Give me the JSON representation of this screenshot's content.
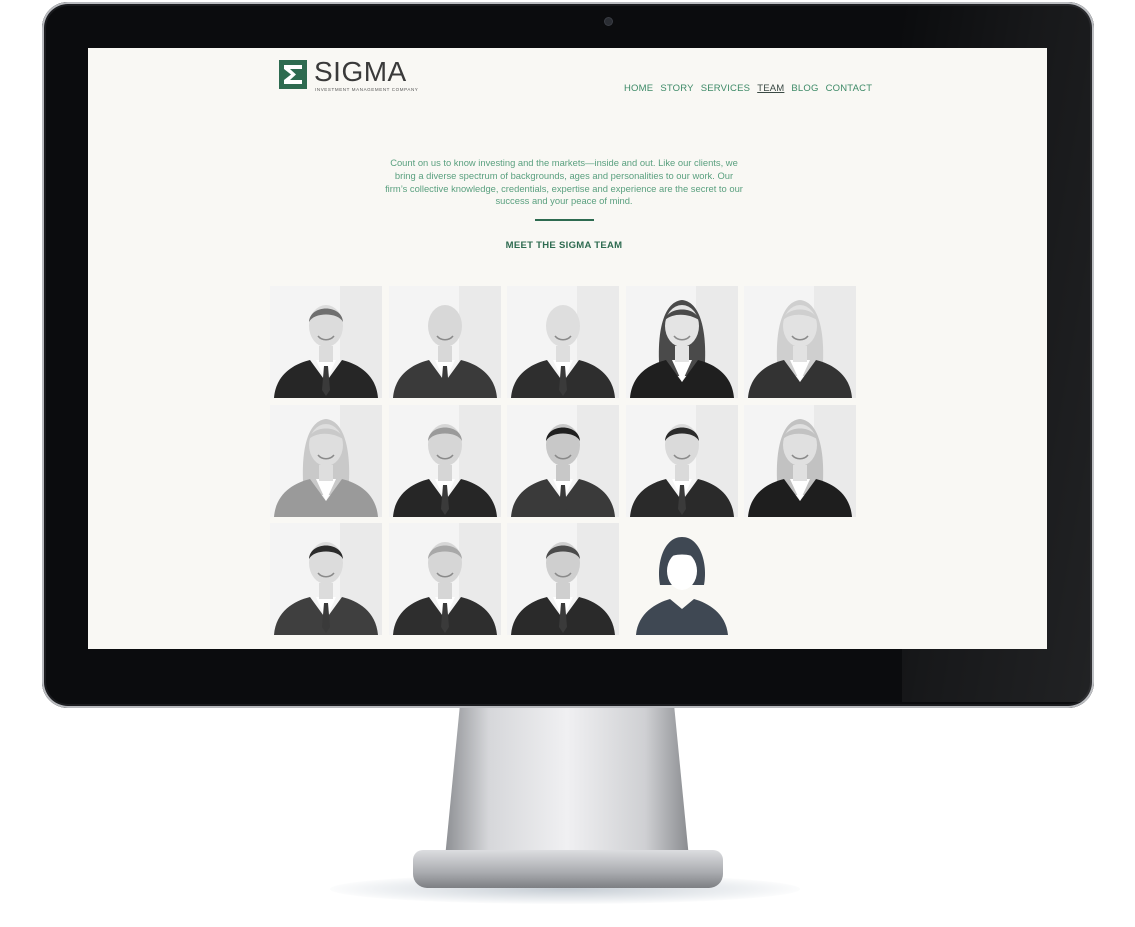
{
  "brand": {
    "name": "SIGMA",
    "tagline": "INVESTMENT MANAGEMENT COMPANY",
    "accent": "#2e6b50"
  },
  "nav": {
    "items": [
      {
        "label": "HOME"
      },
      {
        "label": "STORY"
      },
      {
        "label": "SERVICES"
      },
      {
        "label": "TEAM",
        "active": true
      },
      {
        "label": "BLOG"
      },
      {
        "label": "CONTACT"
      }
    ]
  },
  "intro": {
    "text": "Count on us to know investing and the markets—inside and out. Like our clients, we bring a diverse spectrum of backgrounds, ages and personalities to our work. Our firm’s collective knowledge, credentials, expertise and experience are the secret to our success and your peace of mind."
  },
  "team": {
    "heading": "MEET THE SIGMA TEAM",
    "members": [
      {
        "photo": "portrait-man-1"
      },
      {
        "photo": "portrait-man-2"
      },
      {
        "photo": "portrait-man-3"
      },
      {
        "photo": "portrait-woman-1"
      },
      {
        "photo": "portrait-woman-2"
      },
      {
        "photo": "portrait-woman-3"
      },
      {
        "photo": "portrait-man-4"
      },
      {
        "photo": "portrait-man-5"
      },
      {
        "photo": "portrait-man-6"
      },
      {
        "photo": "portrait-woman-4"
      },
      {
        "photo": "portrait-man-7"
      },
      {
        "photo": "portrait-man-8"
      },
      {
        "photo": "portrait-man-9"
      },
      {
        "photo": "placeholder-avatar-female"
      }
    ]
  }
}
